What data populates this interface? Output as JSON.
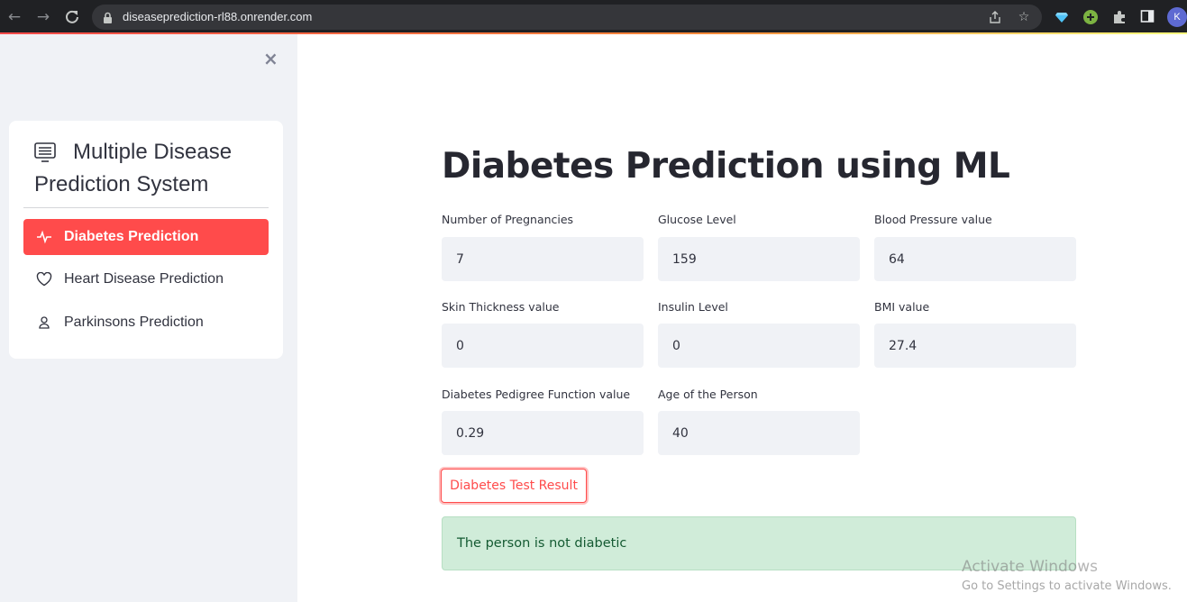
{
  "browser": {
    "url": "diseaseprediction-rl88.onrender.com",
    "avatar_letter": "K"
  },
  "sidebar": {
    "close_symbol": "×",
    "title": "Multiple Disease Prediction System",
    "items": [
      {
        "label": "Diabetes Prediction",
        "icon": "activity-icon",
        "active": true
      },
      {
        "label": "Heart Disease Prediction",
        "icon": "heart-icon",
        "active": false
      },
      {
        "label": "Parkinsons Prediction",
        "icon": "person-icon",
        "active": false
      }
    ]
  },
  "main": {
    "title": "Diabetes Prediction using ML",
    "fields": [
      {
        "label": "Number of Pregnancies",
        "value": "7"
      },
      {
        "label": "Glucose Level",
        "value": "159"
      },
      {
        "label": "Blood Pressure value",
        "value": "64"
      },
      {
        "label": "Skin Thickness value",
        "value": "0"
      },
      {
        "label": "Insulin Level",
        "value": "0"
      },
      {
        "label": "BMI value",
        "value": "27.4"
      },
      {
        "label": "Diabetes Pedigree Function value",
        "value": "0.29"
      },
      {
        "label": "Age of the Person",
        "value": "40"
      }
    ],
    "button_label": "Diabetes Test Result",
    "result_text": "The person is not diabetic"
  },
  "watermark": {
    "line1": "Activate Windows",
    "line2": "Go to Settings to activate Windows."
  },
  "colors": {
    "accent": "#ff4b4b",
    "success_bg": "#d0ecd9",
    "sidebar_bg": "#f0f2f6"
  }
}
